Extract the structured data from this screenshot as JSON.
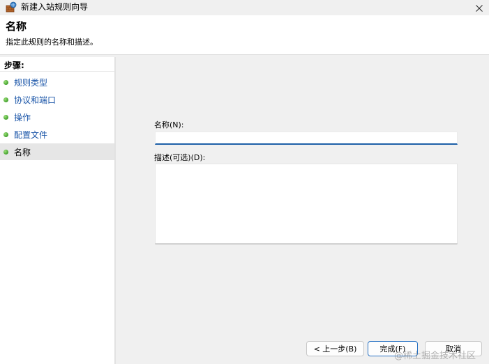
{
  "window": {
    "title": "新建入站规则向导",
    "app_icon": "firewall-rule-icon",
    "close_icon": "close-icon"
  },
  "header": {
    "title": "名称",
    "subtitle": "指定此规则的名称和描述。"
  },
  "sidebar": {
    "heading": "步骤:",
    "items": [
      {
        "label": "规则类型"
      },
      {
        "label": "协议和端口"
      },
      {
        "label": "操作"
      },
      {
        "label": "配置文件"
      },
      {
        "label": "名称"
      }
    ],
    "active_index": 4,
    "bullet_color": "#3f9f2a"
  },
  "form": {
    "name_label": "名称(N):",
    "name_value": "",
    "description_label": "描述(可选)(D):",
    "description_value": ""
  },
  "buttons": {
    "back": "< 上一步(B)",
    "finish": "完成(F)",
    "cancel": "取消"
  },
  "watermark": "@稀土掘金技术社区",
  "colors": {
    "accent": "#1c5fa7",
    "link": "#1a55a8"
  }
}
